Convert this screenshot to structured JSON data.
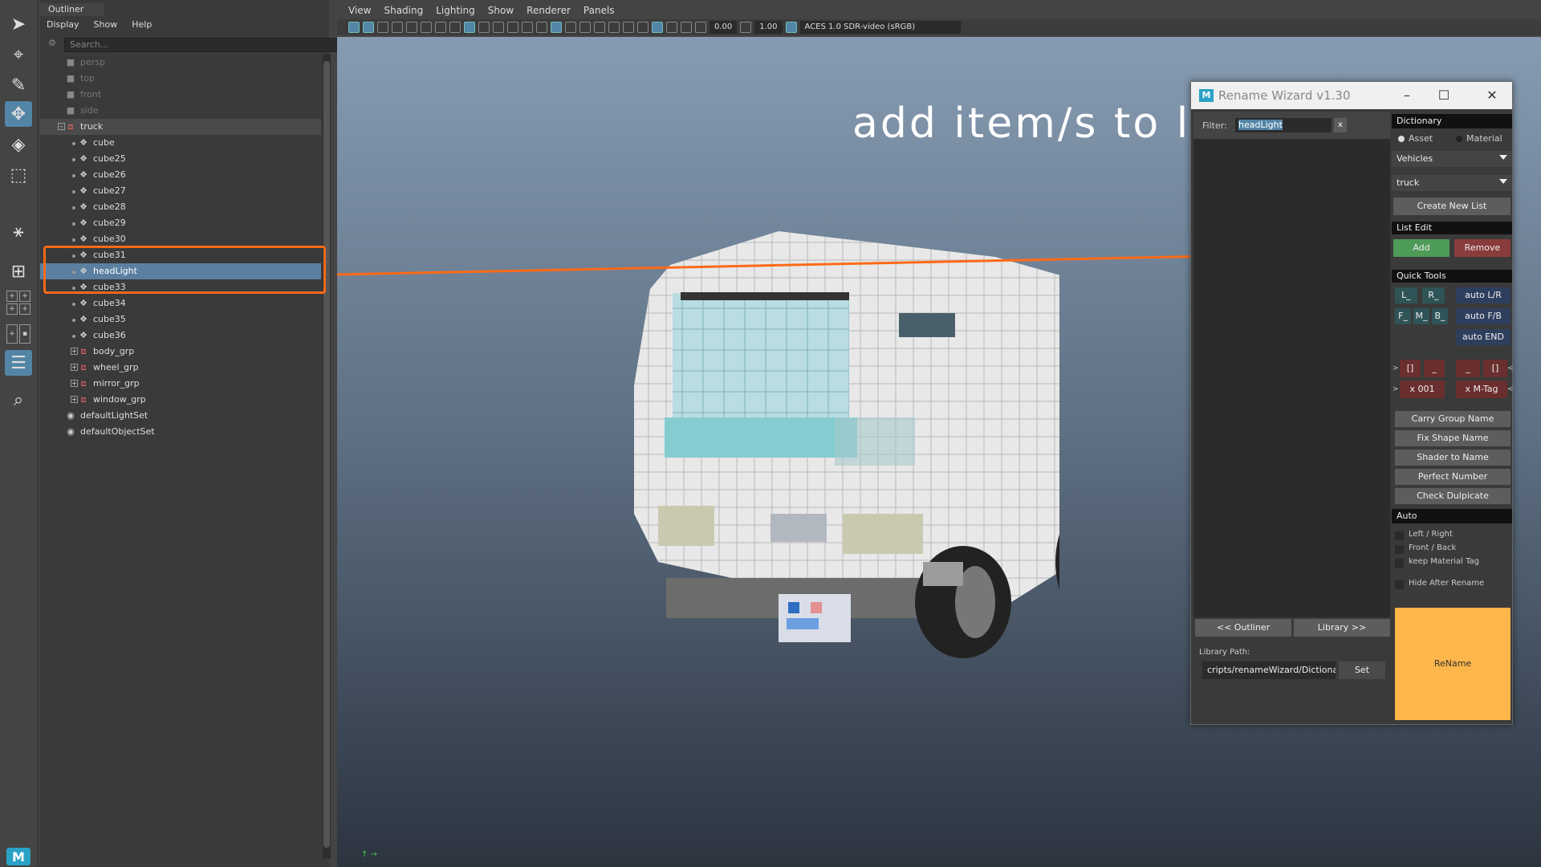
{
  "outliner": {
    "title": "Outliner",
    "menu": [
      "Display",
      "Show",
      "Help"
    ],
    "search_placeholder": "Search...",
    "items": [
      {
        "label": "persp",
        "type": "camera",
        "dim": true
      },
      {
        "label": "top",
        "type": "camera",
        "dim": true
      },
      {
        "label": "front",
        "type": "camera",
        "dim": true
      },
      {
        "label": "side",
        "type": "camera",
        "dim": true
      },
      {
        "label": "truck",
        "type": "group-open"
      },
      {
        "label": "cube",
        "type": "mesh"
      },
      {
        "label": "cube25",
        "type": "mesh"
      },
      {
        "label": "cube26",
        "type": "mesh"
      },
      {
        "label": "cube27",
        "type": "mesh"
      },
      {
        "label": "cube28",
        "type": "mesh"
      },
      {
        "label": "cube29",
        "type": "mesh"
      },
      {
        "label": "cube30",
        "type": "mesh"
      },
      {
        "label": "cube31",
        "type": "mesh"
      },
      {
        "label": "headLight",
        "type": "mesh",
        "selected": true
      },
      {
        "label": "cube33",
        "type": "mesh"
      },
      {
        "label": "cube34",
        "type": "mesh"
      },
      {
        "label": "cube35",
        "type": "mesh"
      },
      {
        "label": "cube36",
        "type": "mesh"
      },
      {
        "label": "body_grp",
        "type": "group"
      },
      {
        "label": "wheel_grp",
        "type": "group"
      },
      {
        "label": "mirror_grp",
        "type": "group"
      },
      {
        "label": "window_grp",
        "type": "group"
      },
      {
        "label": "defaultLightSet",
        "type": "set"
      },
      {
        "label": "defaultObjectSet",
        "type": "set"
      }
    ]
  },
  "viewport": {
    "menu": [
      "View",
      "Shading",
      "Lighting",
      "Show",
      "Renderer",
      "Panels"
    ],
    "exposure": "0.00",
    "gamma": "1.00",
    "colorspace": "ACES 1.0 SDR-video (sRGB)"
  },
  "annotation": {
    "text": "add item/s to list",
    "color": "#ff6a17"
  },
  "wizard": {
    "title": "Rename Wizard v1.30",
    "filter_label": "Filter:",
    "filter_value": "headLight",
    "filter_clear": "x",
    "dictionary": {
      "header": "Dictionary",
      "radio_asset": "Asset",
      "radio_material": "Material",
      "category": "Vehicles",
      "list": "truck",
      "create_btn": "Create New List"
    },
    "list_edit": {
      "header": "List Edit",
      "add": "Add",
      "remove": "Remove"
    },
    "quick_tools": {
      "header": "Quick Tools",
      "l": "L_",
      "r": "R_",
      "auto_lr": "auto L/R",
      "f": "F_",
      "m": "M_",
      "b": "B_",
      "auto_fb": "auto F/B",
      "auto_end": "auto END",
      "prefix_arrow": ">",
      "suffix_arrow": "<",
      "bracket_left": "[]",
      "underscore_left": "_",
      "underscore_right": "_",
      "bracket_right": "[]",
      "x001": "x 001",
      "xmtag": "x M-Tag"
    },
    "actions": [
      "Carry Group Name",
      "Fix Shape Name",
      "Shader to Name",
      "Perfect Number",
      "Check Dulpicate"
    ],
    "auto": {
      "header": "Auto",
      "options": [
        "Left / Right",
        "Front / Back",
        "keep Material Tag"
      ],
      "hide_after": "Hide After Rename"
    },
    "nav_outliner": "<< Outliner",
    "nav_library": "Library >>",
    "library_path_label": "Library Path:",
    "library_path": "cripts/renameWizard/Dictionary",
    "set_btn": "Set",
    "rename_btn": "ReName",
    "colors": {
      "add": "#4e9a57",
      "remove": "#8a3c3c",
      "rename": "#fdb64a",
      "quick_dark": "#2e3f5e",
      "quick_teal": "#2f5457",
      "quick_red": "#6b2e2e"
    }
  }
}
